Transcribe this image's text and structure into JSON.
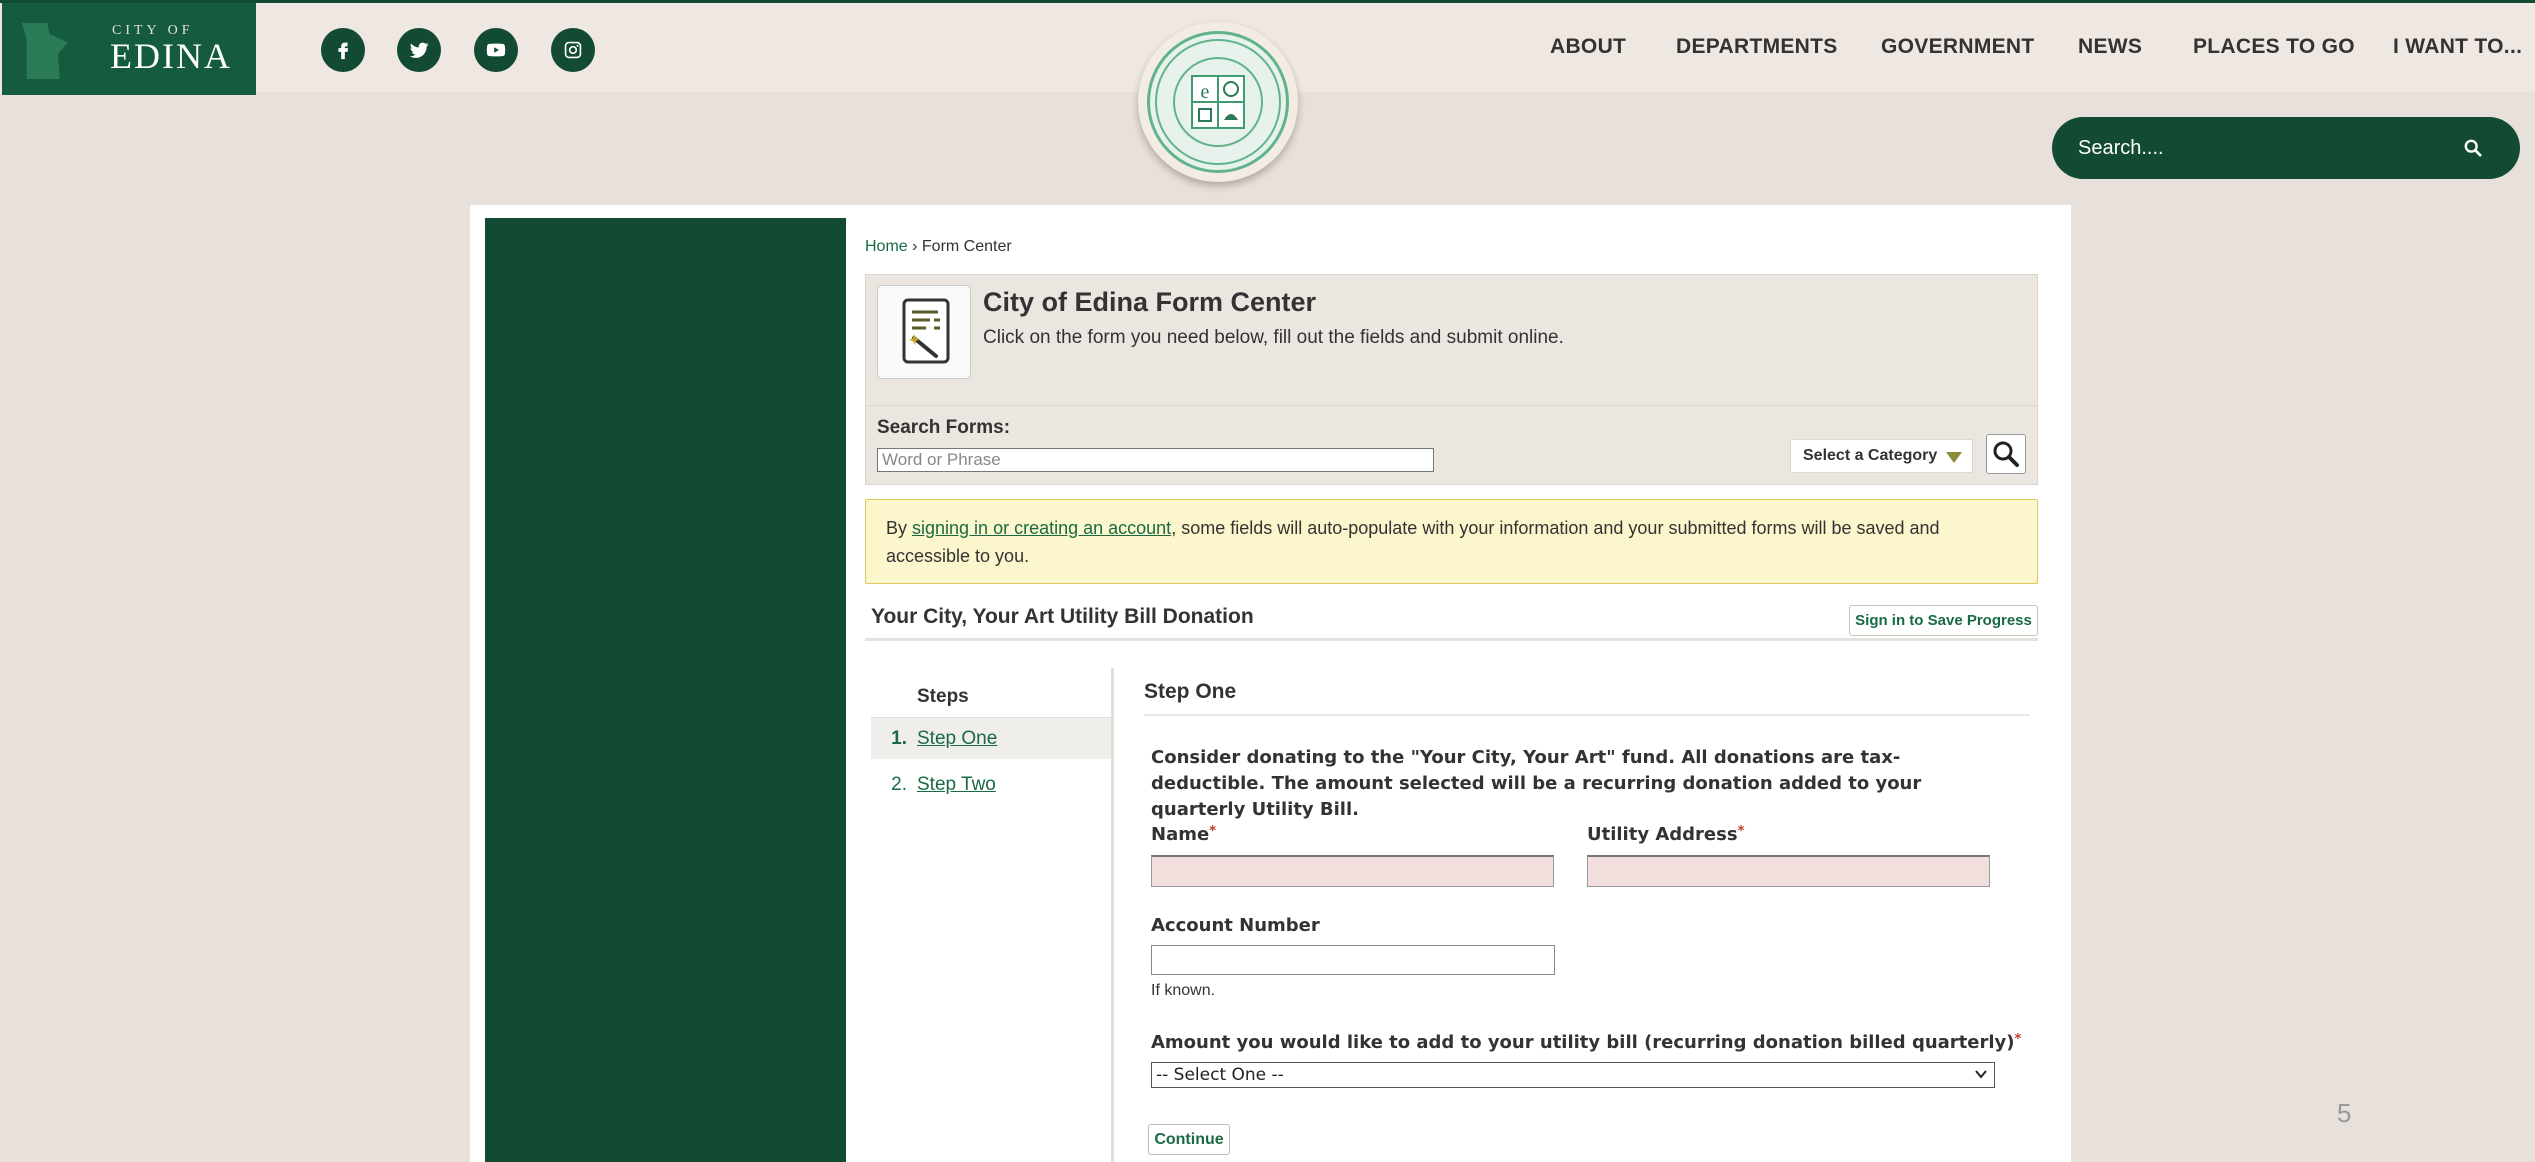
{
  "header": {
    "logo_city_of": "CITY OF",
    "logo_name": "EDINA",
    "social": [
      {
        "icon": "facebook-icon"
      },
      {
        "icon": "twitter-icon"
      },
      {
        "icon": "youtube-icon"
      },
      {
        "icon": "instagram-icon"
      }
    ],
    "nav": [
      "ABOUT",
      "DEPARTMENTS",
      "GOVERNMENT",
      "NEWS",
      "PLACES TO GO",
      "I WANT TO..."
    ],
    "search_placeholder": "Search...."
  },
  "breadcrumb": {
    "home": "Home",
    "separator": " › ",
    "current": "Form Center"
  },
  "form_center": {
    "title": "City of Edina Form Center",
    "subtitle": "Click on the form you need below, fill out the fields and submit online.",
    "search_label": "Search Forms:",
    "search_placeholder": "Word or Phrase",
    "category_label": "Select a Category"
  },
  "notice": {
    "prefix": "By ",
    "link": "signing in or creating an account",
    "suffix": ", some fields will auto-populate with your information and your submitted forms will be saved and accessible to you."
  },
  "form": {
    "title": "Your City, Your Art Utility Bill Donation",
    "save_label": "Sign in to Save Progress",
    "steps_heading": "Steps",
    "steps": [
      {
        "num": "1.",
        "label": "Step One"
      },
      {
        "num": "2.",
        "label": "Step Two"
      }
    ],
    "step_title": "Step One",
    "intro": "Consider donating to the \"Your City, Your Art\" fund. All donations are tax-deductible. The amount selected will be a recurring donation added to your quarterly Utility Bill.",
    "name_label": "Name",
    "address_label": "Utility Address",
    "account_label": "Account Number",
    "account_hint": "If known.",
    "amount_label": "Amount you would like to add to your utility bill (recurring donation billed quarterly)",
    "amount_selected": "-- Select One --",
    "required_mark": "*",
    "continue_label": "Continue"
  },
  "slide_number": "5",
  "colors": {
    "brand_green": "#124a33",
    "link_green": "#1a6a45",
    "page_bg": "#e8e0da",
    "notice_bg": "#fbf6cc",
    "required_field_bg": "#f3dede"
  }
}
